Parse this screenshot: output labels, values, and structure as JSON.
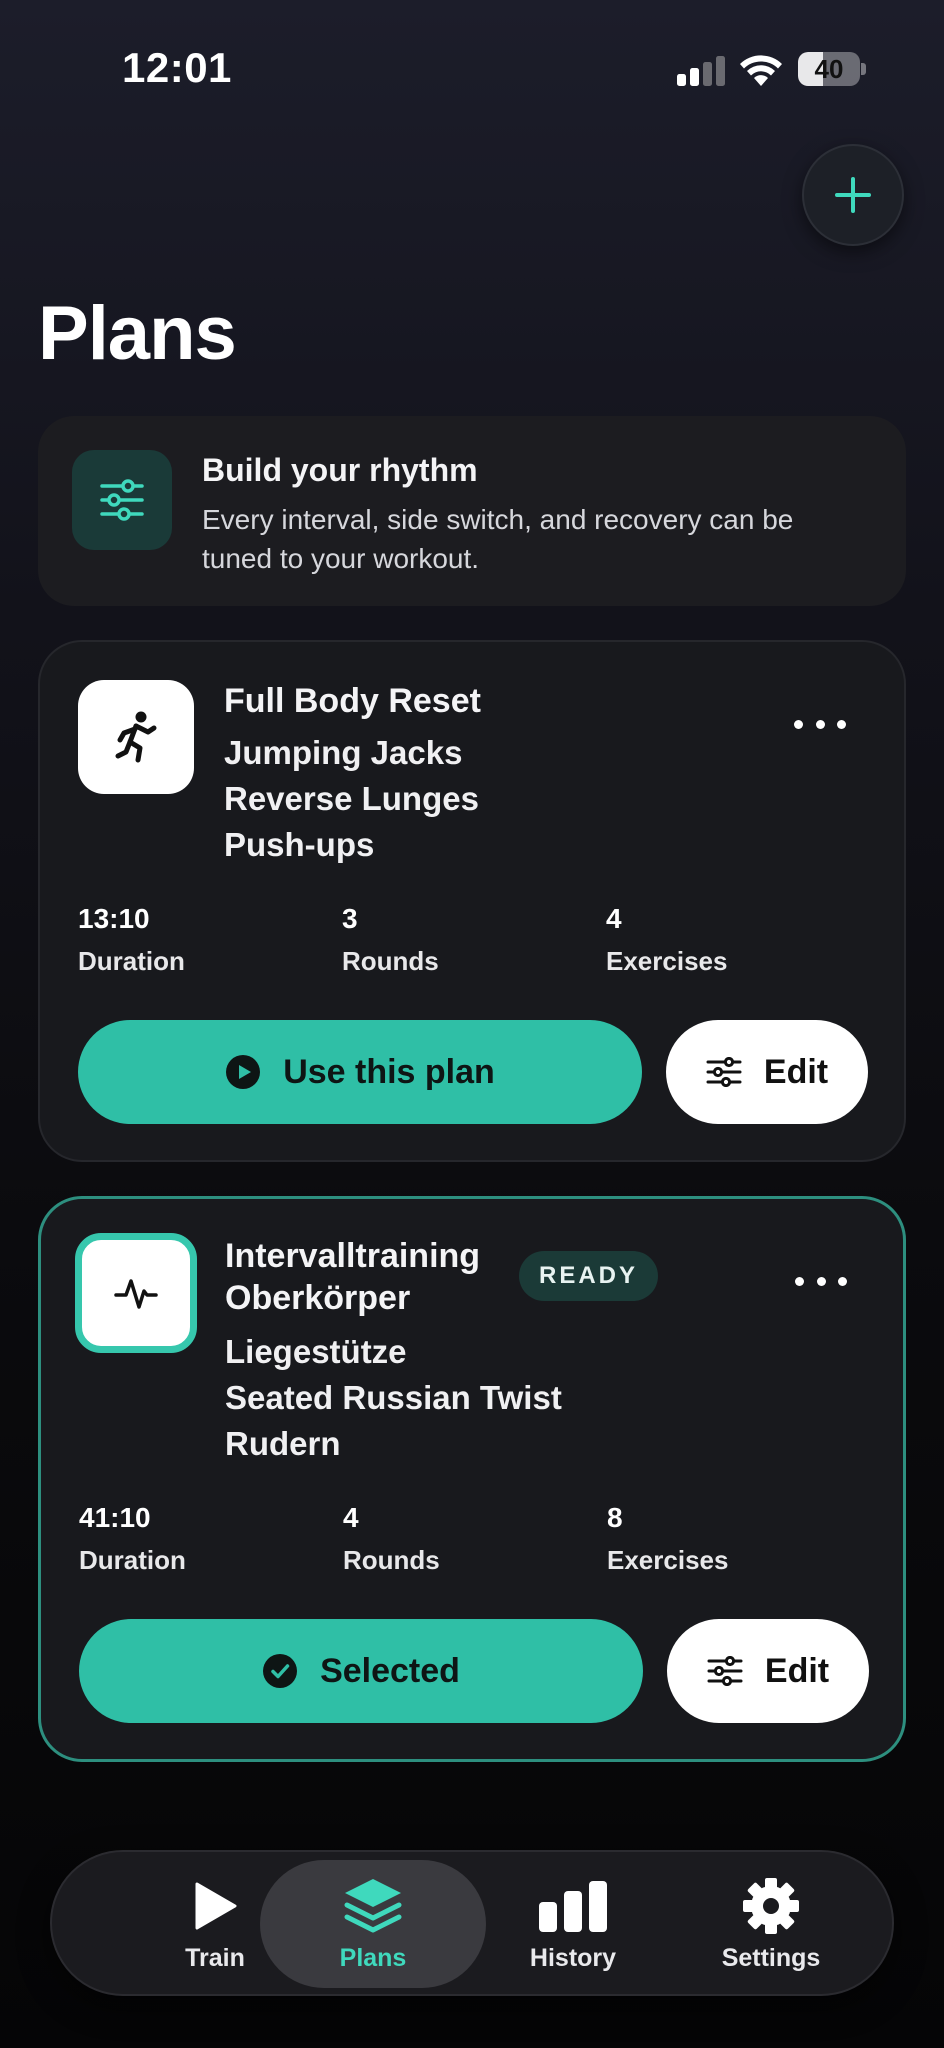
{
  "status_bar": {
    "time": "12:01",
    "battery": "40",
    "battery_level": 0.4
  },
  "header": {
    "title": "Plans",
    "add_icon": "plus-icon"
  },
  "info_card": {
    "icon": "sliders-icon",
    "title": "Build your rhythm",
    "text": "Every interval, side switch, and recovery can be tuned to your workout."
  },
  "plans": [
    {
      "icon": "running-figure-icon",
      "name": "Full Body Reset",
      "exercises": [
        "Jumping Jacks",
        "Reverse Lunges",
        "Push-ups"
      ],
      "stats": [
        {
          "value": "13:10",
          "label": "Duration"
        },
        {
          "value": "3",
          "label": "Rounds"
        },
        {
          "value": "4",
          "label": "Exercises"
        }
      ],
      "primary_label": "Use this plan",
      "edit_label": "Edit",
      "selected": false
    },
    {
      "icon": "pulse-icon",
      "name_line1": "Intervalltraining",
      "name_line2": "Oberkörper",
      "badge": "READY",
      "exercises": [
        "Liegestütze",
        "Seated Russian Twist",
        "Rudern"
      ],
      "stats": [
        {
          "value": "41:10",
          "label": "Duration"
        },
        {
          "value": "4",
          "label": "Rounds"
        },
        {
          "value": "8",
          "label": "Exercises"
        }
      ],
      "primary_label": "Selected",
      "edit_label": "Edit",
      "selected": true
    }
  ],
  "tab_bar": {
    "tabs": [
      {
        "label": "Train",
        "icon": "play-icon"
      },
      {
        "label": "Plans",
        "icon": "stack-icon",
        "active": true
      },
      {
        "label": "History",
        "icon": "bar-chart-icon"
      },
      {
        "label": "Settings",
        "icon": "gear-icon"
      }
    ]
  },
  "colors": {
    "accent": "#2fbfa6",
    "accent_text": "#3fd9bd",
    "card": "#18191d"
  }
}
